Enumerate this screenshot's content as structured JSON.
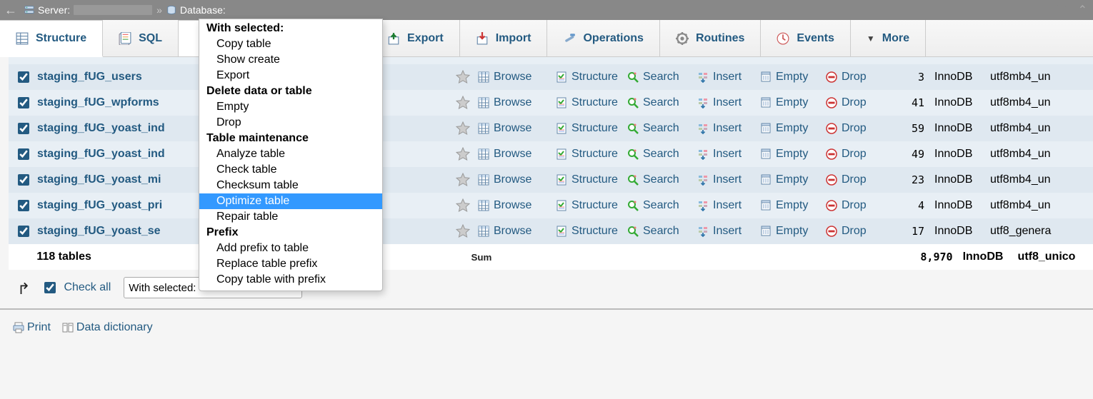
{
  "breadcrumb": {
    "server_label": "Server:",
    "database_label": "Database:"
  },
  "tabs": {
    "structure": "Structure",
    "sql": "SQL",
    "export": "Export",
    "import": "Import",
    "operations": "Operations",
    "routines": "Routines",
    "events": "Events",
    "more": "More"
  },
  "actions": {
    "browse": "Browse",
    "structure": "Structure",
    "search": "Search",
    "insert": "Insert",
    "empty": "Empty",
    "drop": "Drop"
  },
  "rows": [
    {
      "checked": true,
      "name": "staging_fUG_users",
      "rows": "3",
      "type": "InnoDB",
      "collation": "utf8mb4_un",
      "alt": "odd"
    },
    {
      "checked": true,
      "name": "staging_fUG_wpforms",
      "rows": "41",
      "type": "InnoDB",
      "collation": "utf8mb4_un",
      "alt": "even"
    },
    {
      "checked": true,
      "name": "staging_fUG_yoast_ind",
      "rows": "59",
      "type": "InnoDB",
      "collation": "utf8mb4_un",
      "alt": "odd"
    },
    {
      "checked": true,
      "name": "staging_fUG_yoast_ind",
      "rows": "49",
      "type": "InnoDB",
      "collation": "utf8mb4_un",
      "alt": "even"
    },
    {
      "checked": true,
      "name": "staging_fUG_yoast_mi",
      "rows": "23",
      "type": "InnoDB",
      "collation": "utf8mb4_un",
      "alt": "odd"
    },
    {
      "checked": true,
      "name": "staging_fUG_yoast_pri",
      "rows": "4",
      "type": "InnoDB",
      "collation": "utf8mb4_un",
      "alt": "even"
    },
    {
      "checked": true,
      "name": "staging_fUG_yoast_se",
      "rows": "17",
      "type": "InnoDB",
      "collation": "utf8_genera",
      "alt": "odd"
    }
  ],
  "summary": {
    "tables_label": "118 tables",
    "sum_label": "Sum",
    "sum_rows": "8,970",
    "sum_type": "InnoDB",
    "sum_collation": "utf8_unico"
  },
  "footer": {
    "check_all": "Check all",
    "with_selected_placeholder": "With selected:",
    "print": "Print",
    "data_dictionary": "Data dictionary"
  },
  "dropdown": {
    "with_selected": "With selected:",
    "items": [
      {
        "type": "item",
        "label": "Copy table"
      },
      {
        "type": "item",
        "label": "Show create"
      },
      {
        "type": "item",
        "label": "Export"
      },
      {
        "type": "hdr",
        "label": "Delete data or table"
      },
      {
        "type": "item",
        "label": "Empty"
      },
      {
        "type": "item",
        "label": "Drop"
      },
      {
        "type": "hdr",
        "label": "Table maintenance"
      },
      {
        "type": "item",
        "label": "Analyze table"
      },
      {
        "type": "item",
        "label": "Check table"
      },
      {
        "type": "item",
        "label": "Checksum table"
      },
      {
        "type": "item",
        "label": "Optimize table",
        "selected": true
      },
      {
        "type": "item",
        "label": "Repair table"
      },
      {
        "type": "hdr",
        "label": "Prefix"
      },
      {
        "type": "item",
        "label": "Add prefix to table"
      },
      {
        "type": "item",
        "label": "Replace table prefix"
      },
      {
        "type": "item",
        "label": "Copy table with prefix"
      }
    ]
  }
}
